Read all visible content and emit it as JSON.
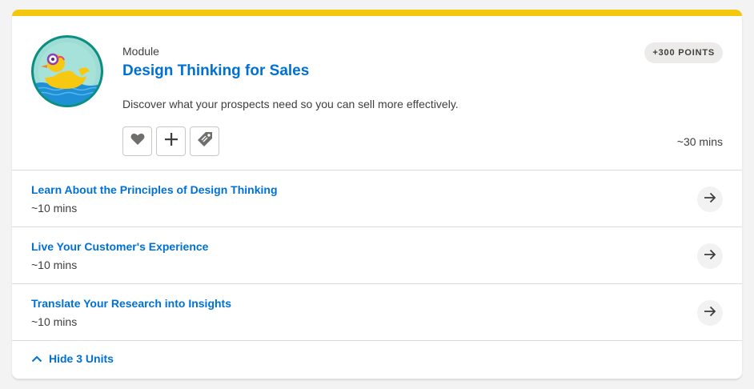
{
  "module": {
    "eyebrow": "Module",
    "title": "Design Thinking for Sales",
    "description": "Discover what your prospects need so you can sell more effectively.",
    "points": "+300 POINTS",
    "duration": "~30 mins",
    "badge_icon": "rubber-duck-badge"
  },
  "actions": [
    {
      "icon": "heart-icon"
    },
    {
      "icon": "plus-icon"
    },
    {
      "icon": "tag-icon"
    }
  ],
  "units": [
    {
      "title": "Learn About the Principles of Design Thinking",
      "time": "~10 mins"
    },
    {
      "title": "Live Your Customer's Experience",
      "time": "~10 mins"
    },
    {
      "title": "Translate Your Research into Insights",
      "time": "~10 mins"
    }
  ],
  "footer": {
    "toggle_label": "Hide 3 Units"
  },
  "colors": {
    "accent_bar": "#f4c70f",
    "link": "#0070d2",
    "badge_bg": "#0b9a8c"
  }
}
